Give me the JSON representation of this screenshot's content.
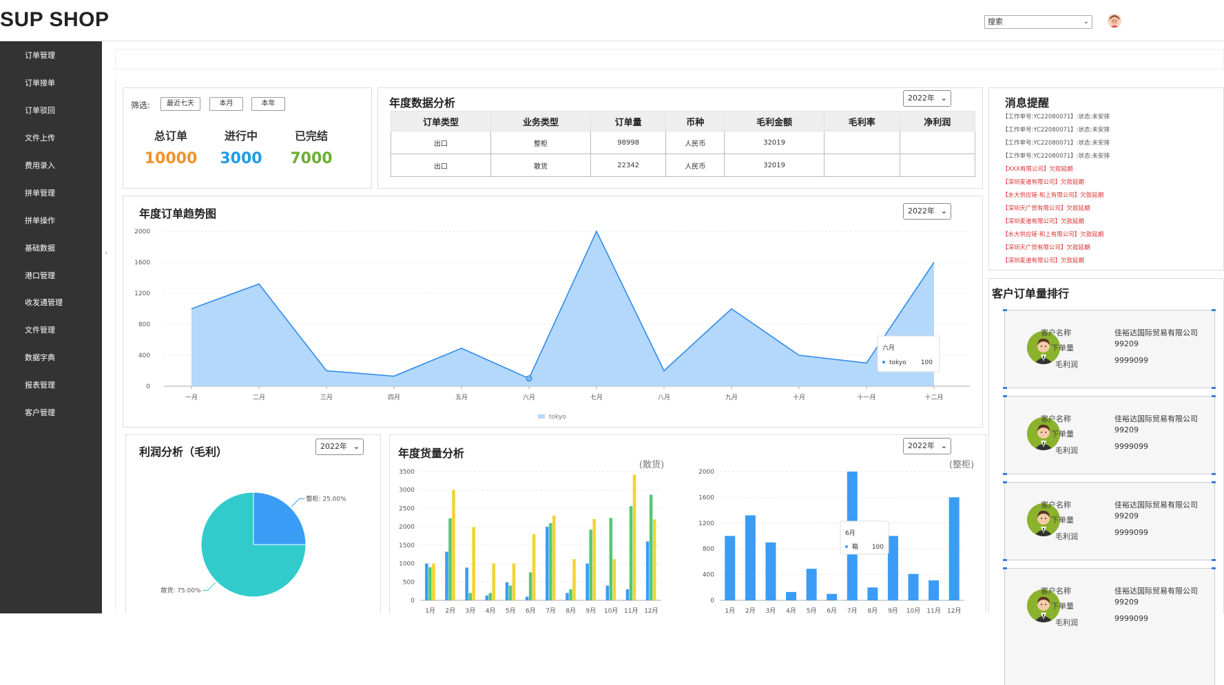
{
  "header": {
    "logo": "SUP SHOP",
    "search_placeholder": "搜索"
  },
  "sidebar": {
    "items": [
      "订单管理",
      "订单接单",
      "订单驳回",
      "文件上传",
      "费用录入",
      "拼单管理",
      "拼单操作",
      "基础数据",
      "港口管理",
      "收发通管理",
      "文件管理",
      "数据字典",
      "报表管理",
      "客户管理"
    ]
  },
  "filter": {
    "label": "筛选:",
    "buttons": [
      "最近七天",
      "本月",
      "本年"
    ]
  },
  "stats": [
    {
      "label": "总订单",
      "value": "10000",
      "color": "#f0932b"
    },
    {
      "label": "进行中",
      "value": "3000",
      "color": "#1e9be6"
    },
    {
      "label": "已完结",
      "value": "7000",
      "color": "#6ab033"
    }
  ],
  "annual": {
    "title": "年度数据分析",
    "year": "2022年",
    "columns": [
      "订单类型",
      "业务类型",
      "订单量",
      "币种",
      "毛利金额",
      "毛利率",
      "净利润"
    ],
    "rows": [
      [
        "出口",
        "整柜",
        "98998",
        "人民币",
        "32019",
        "",
        ""
      ],
      [
        "出口",
        "散货",
        "22342",
        "人民币",
        "32019",
        "",
        ""
      ]
    ]
  },
  "messages": {
    "title": "消息提醒",
    "items": [
      {
        "text": "【工作单号:YC22080071】:状态:未安排",
        "color": "#555"
      },
      {
        "text": "【工作单号:YC22080071】:状态:未安排",
        "color": "#555"
      },
      {
        "text": "【工作单号:YC22080071】:状态:未安排",
        "color": "#555"
      },
      {
        "text": "【工作单号:YC22080071】:状态:未安排",
        "color": "#555"
      },
      {
        "text": "【XXX有限公司】欠款延期",
        "color": "#d9302f"
      },
      {
        "text": "【深圳麦道有限公司】欠款延期",
        "color": "#d9302f"
      },
      {
        "text": "【水大供应链·和上有限公司】欠款延期",
        "color": "#d9302f"
      },
      {
        "text": "【深圳天广贸有限公司】欠款延期",
        "color": "#d9302f"
      },
      {
        "text": "【深圳麦道有限公司】欠款延期",
        "color": "#d9302f"
      },
      {
        "text": "【水大供应链·和上有限公司】欠款延期",
        "color": "#d9302f"
      },
      {
        "text": "【深圳天广贸有限公司】欠款延期",
        "color": "#d9302f"
      },
      {
        "text": "【深圳麦道有限公司】欠款延期",
        "color": "#d9302f"
      }
    ]
  },
  "ranking": {
    "title": "客户订单量排行",
    "labels": {
      "name": "客户名称",
      "orders": "下单量",
      "profit": "毛利润"
    },
    "customers": [
      {
        "name": "佳裕达国际贸易有限公司",
        "orders": "99209",
        "profit": "9999099"
      },
      {
        "name": "佳裕达国际贸易有限公司",
        "orders": "99209",
        "profit": "9999099"
      },
      {
        "name": "佳裕达国际贸易有限公司",
        "orders": "99209",
        "profit": "9999099"
      },
      {
        "name": "佳裕达国际贸易有限公司",
        "orders": "99209",
        "profit": "9999099"
      }
    ]
  },
  "trend": {
    "title": "年度订单趋势图",
    "year": "2022年",
    "tooltip": {
      "title": "六月",
      "series": "tokyo",
      "value": "100"
    }
  },
  "profit": {
    "title": "利润分析（毛利）",
    "year": "2022年"
  },
  "cargo": {
    "title": "年度货量分析",
    "year": "2022年",
    "left_subtitle": "(散货)",
    "right_subtitle": "(整柜)",
    "tooltip": {
      "title": "6月",
      "series": "箱",
      "value": "100"
    }
  },
  "chart_data": [
    {
      "type": "area",
      "x": [
        "一月",
        "二月",
        "三月",
        "四月",
        "五月",
        "六月",
        "七月",
        "八月",
        "九月",
        "十月",
        "十一月",
        "十二月"
      ],
      "series": [
        {
          "name": "tokyo",
          "values": [
            1000,
            1320,
            200,
            130,
            490,
            100,
            2000,
            200,
            1000,
            400,
            300,
            1600
          ]
        }
      ],
      "ylim": [
        0,
        2000
      ],
      "yticks": [
        0,
        400,
        800,
        1200,
        1600,
        2000
      ],
      "color": "#2f8bea",
      "fill": "#b3d8fb",
      "legend": "bottom"
    },
    {
      "type": "pie",
      "slices": [
        {
          "name": "整柜",
          "value": 25,
          "label": "整柜: 25.00%",
          "color": "#3a9cf4"
        },
        {
          "name": "散货",
          "value": 75,
          "label": "散货: 75.00%",
          "color": "#32cbcc"
        }
      ]
    },
    {
      "type": "bar",
      "categories": [
        "1月",
        "2月",
        "3月",
        "4月",
        "5月",
        "6月",
        "7月",
        "8月",
        "9月",
        "10月",
        "11月",
        "12月"
      ],
      "series": [
        {
          "values": [
            1000,
            1320,
            890,
            130,
            490,
            100,
            2000,
            200,
            1000,
            400,
            300,
            1600
          ],
          "color": "#3a9cf4"
        },
        {
          "values": [
            900,
            2230,
            200,
            200,
            400,
            760,
            2100,
            300,
            1920,
            2240,
            2560,
            2870
          ],
          "color": "#52c973"
        },
        {
          "values": [
            1000,
            3000,
            1990,
            1000,
            1000,
            1800,
            2300,
            1120,
            2210,
            1120,
            3420,
            2200
          ],
          "color": "#f4d233"
        }
      ],
      "ylim": [
        0,
        3500
      ],
      "yticks": [
        0,
        500,
        1000,
        1500,
        2000,
        2500,
        3000,
        3500
      ]
    },
    {
      "type": "bar",
      "categories": [
        "1月",
        "2月",
        "3月",
        "4月",
        "5月",
        "6月",
        "7月",
        "8月",
        "9月",
        "10月",
        "11月",
        "12月"
      ],
      "series": [
        {
          "name": "箱",
          "values": [
            1000,
            1320,
            900,
            130,
            490,
            100,
            2000,
            200,
            1000,
            410,
            310,
            1600
          ],
          "color": "#3a9cf4"
        }
      ],
      "ylim": [
        0,
        2000
      ],
      "yticks": [
        0,
        400,
        800,
        1200,
        1600,
        2000
      ]
    }
  ]
}
